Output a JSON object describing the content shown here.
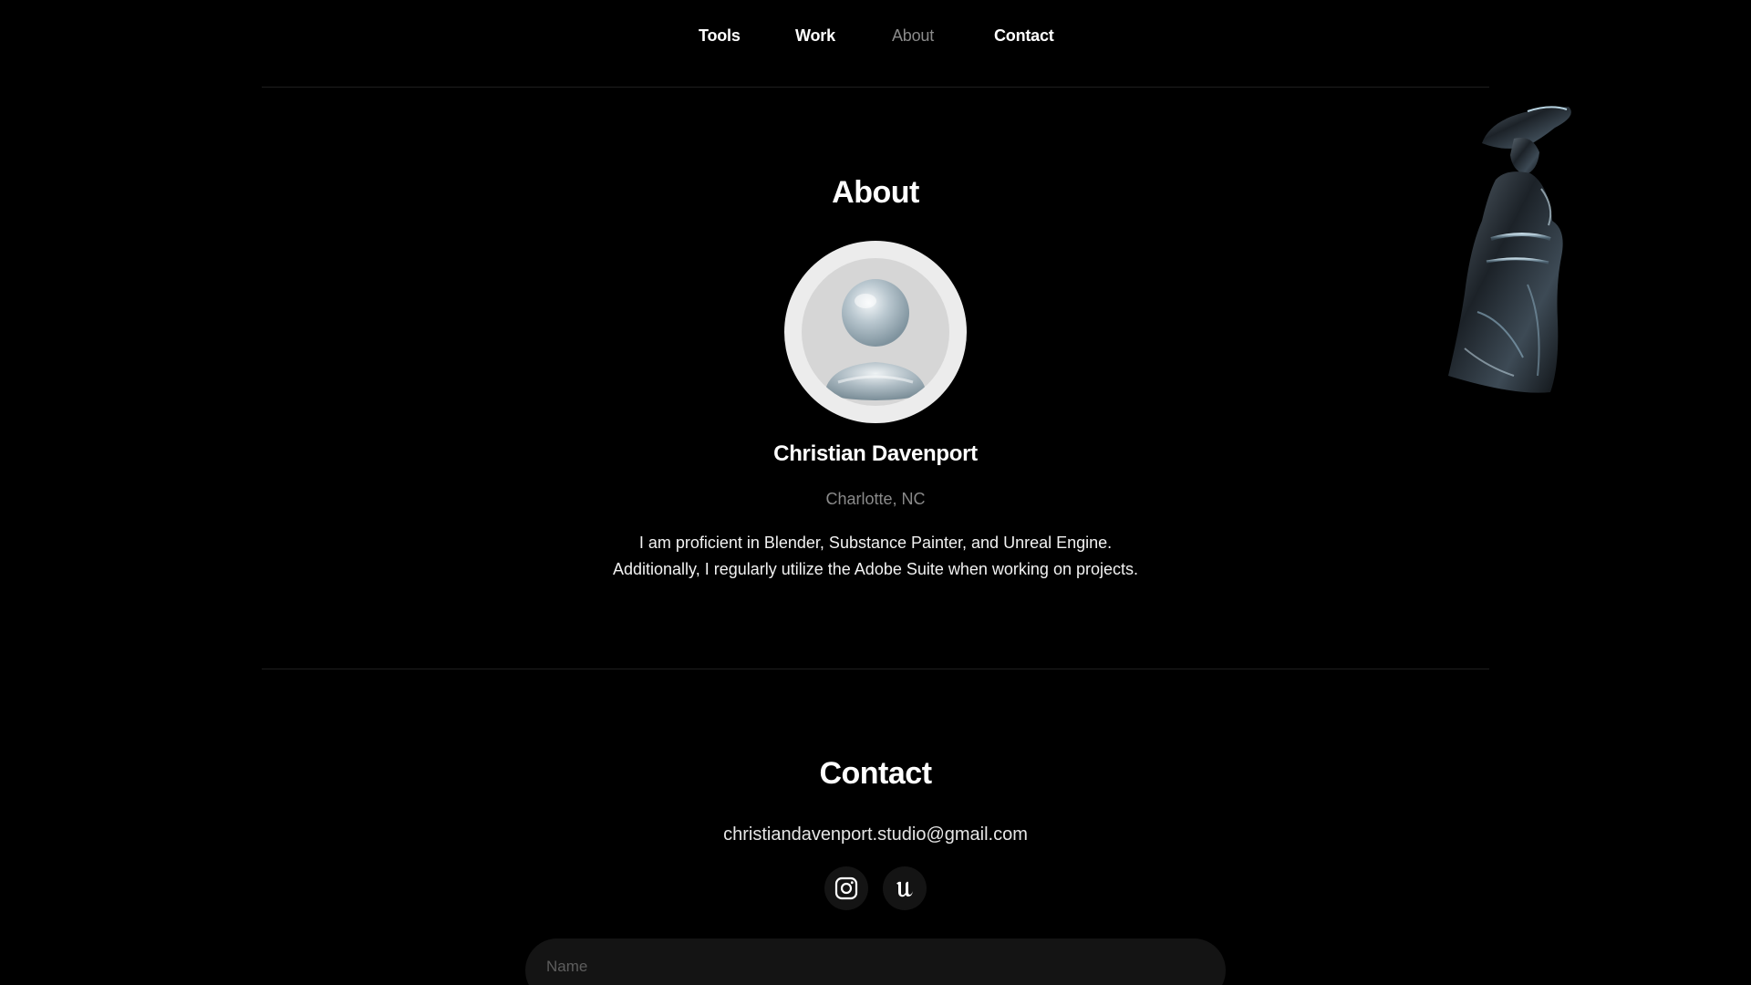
{
  "nav": {
    "items": [
      {
        "label": "Tools"
      },
      {
        "label": "Work"
      },
      {
        "label": "About"
      },
      {
        "label": "Contact"
      }
    ],
    "active": "About"
  },
  "about": {
    "title": "About",
    "name": "Christian Davenport",
    "location": "Charlotte, NC",
    "bio_line1": "I am proficient in Blender, Substance Painter, and Unreal Engine.",
    "bio_line2": "Additionally, I regularly utilize the Adobe Suite when working on projects."
  },
  "contact": {
    "title": "Contact",
    "email": "christiandavenport.studio@gmail.com",
    "socials": [
      {
        "icon": "instagram-icon"
      },
      {
        "icon": "unreal-engine-icon"
      }
    ],
    "name_placeholder": "Name"
  },
  "colors": {
    "background": "#000000",
    "muted_text": "#8a8a8a",
    "field_background": "#141414"
  }
}
